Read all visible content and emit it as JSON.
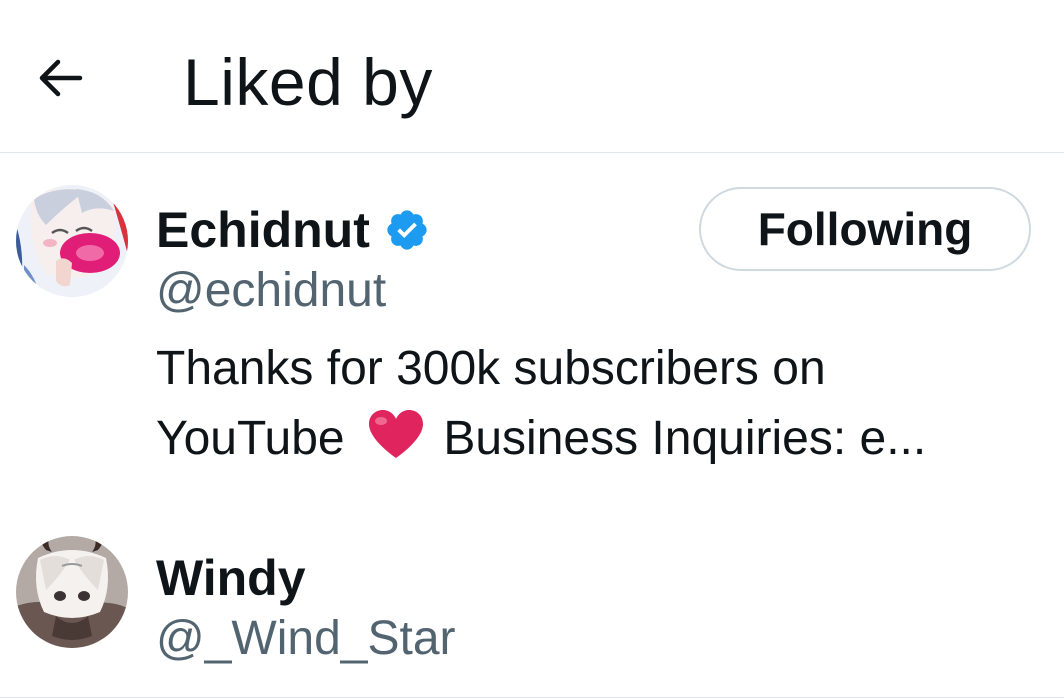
{
  "header": {
    "title": "Liked by",
    "back_icon": "arrow-left-icon"
  },
  "users": [
    {
      "name": "Echidnut",
      "handle": "@echidnut",
      "verified": true,
      "follow_label": "Following",
      "bio_line1": "Thanks for 300k subscribers on",
      "bio_before_emoji": "YouTube",
      "bio_emoji": "red-heart-icon",
      "bio_after_emoji": "Business Inquiries: e..."
    },
    {
      "name": "Windy",
      "handle": "@_Wind_Star"
    }
  ],
  "colors": {
    "text_primary": "#0f1419",
    "text_secondary": "#536471",
    "verified_badge": "#1d9bf0",
    "border": "#cfd9de",
    "heart": "#e0245e"
  }
}
